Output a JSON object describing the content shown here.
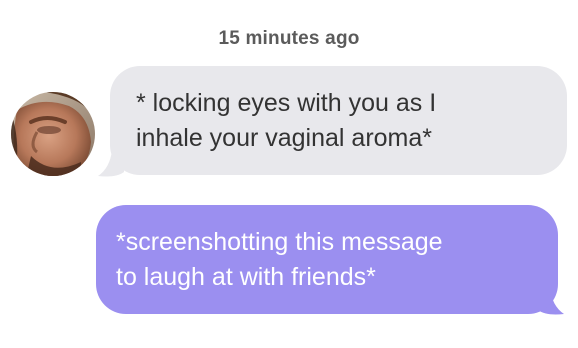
{
  "conversation": {
    "timestamp": "15 minutes ago",
    "incoming": {
      "line1": "* locking eyes with you as I",
      "line2": "inhale your vaginal aroma*",
      "bubble_color": "#e8e8ec",
      "text_color": "#333333"
    },
    "outgoing": {
      "line1": "*screenshotting this message",
      "line2": "to laugh at with friends*",
      "bubble_color": "#9b8ff0",
      "text_color": "#ffffff"
    },
    "sender_avatar": {
      "icon": "profile-photo"
    }
  }
}
